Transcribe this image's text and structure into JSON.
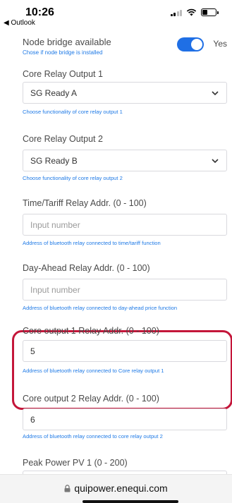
{
  "status_bar": {
    "time": "10:26",
    "back_app": "◀ Outlook"
  },
  "node_bridge": {
    "title": "Node bridge available",
    "help": "Chose if node bridge is installed",
    "toggle_label": "Yes",
    "enabled": true
  },
  "core_relay_1": {
    "label": "Core Relay Output 1",
    "value": "SG Ready A",
    "help": "Choose functionality of core relay output 1"
  },
  "core_relay_2": {
    "label": "Core Relay Output 2",
    "value": "SG Ready B",
    "help": "Choose functionality of core relay output 2"
  },
  "time_tariff": {
    "label": "Time/Tariff Relay Addr. (0 - 100)",
    "placeholder": "Input number",
    "help": "Address of bluetooth relay connected to time/tariff function"
  },
  "day_ahead": {
    "label": "Day-Ahead Relay Addr. (0 - 100)",
    "placeholder": "Input number",
    "help": "Address of bluetooth relay connected to day-ahead price function"
  },
  "core_out_1": {
    "label": "Core output 1 Relay Addr. (0 - 100)",
    "value": "5",
    "help": "Address of bluetooth relay connected to Core relay output 1"
  },
  "core_out_2": {
    "label": "Core output 2 Relay Addr. (0 - 100)",
    "value": "6",
    "help": "Address of bluetooth relay connected to core relay output 2"
  },
  "peak_power": {
    "label": "Peak Power PV 1 (0 - 200)"
  },
  "browser": {
    "url": "quipower.enequi.com"
  },
  "colors": {
    "accent": "#1f6fe5",
    "help_text": "#1f7ae6",
    "highlight": "#c4163a"
  },
  "icons": {
    "signal": "cellular-signal-icon",
    "wifi": "wifi-icon",
    "battery": "battery-icon",
    "chevron": "chevron-down-icon",
    "lock": "lock-icon"
  }
}
